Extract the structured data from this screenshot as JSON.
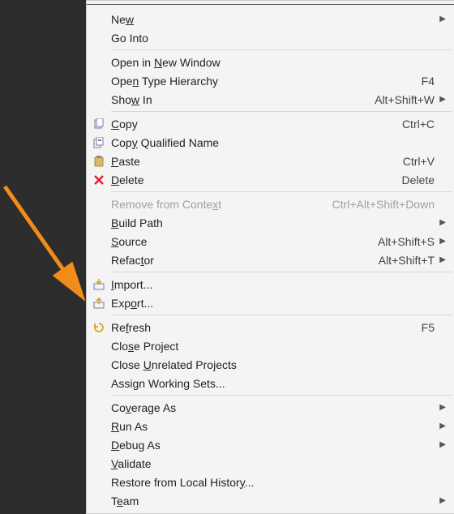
{
  "menu": {
    "groups": [
      [
        {
          "id": "new",
          "label": "Ne<u>w</u>",
          "submenu": true
        },
        {
          "id": "go-into",
          "label": "Go Into"
        }
      ],
      [
        {
          "id": "open-new-window",
          "label": "Open in <u>N</u>ew Window"
        },
        {
          "id": "open-type-hier",
          "label": "Ope<u>n</u> Type Hierarchy",
          "shortcut": "F4"
        },
        {
          "id": "show-in",
          "label": "Sho<u>w</u> In",
          "shortcut": "Alt+Shift+W",
          "submenu": true
        }
      ],
      [
        {
          "id": "copy",
          "label": "<u>C</u>opy",
          "shortcut": "Ctrl+C",
          "icon": "copy-icon"
        },
        {
          "id": "copy-qualified",
          "label": "Cop<u>y</u> Qualified Name",
          "icon": "copy-qualified-icon"
        },
        {
          "id": "paste",
          "label": "<u>P</u>aste",
          "shortcut": "Ctrl+V",
          "icon": "paste-icon"
        },
        {
          "id": "delete",
          "label": "<u>D</u>elete",
          "shortcut": "Delete",
          "icon": "delete-icon"
        }
      ],
      [
        {
          "id": "remove-context",
          "label": "Remove from Conte<u>x</u>t",
          "shortcut": "Ctrl+Alt+Shift+Down",
          "disabled": true
        },
        {
          "id": "build-path",
          "label": "<u>B</u>uild Path",
          "submenu": true
        },
        {
          "id": "source",
          "label": "<u>S</u>ource",
          "shortcut": "Alt+Shift+S",
          "submenu": true
        },
        {
          "id": "refactor",
          "label": "Refac<u>t</u>or",
          "shortcut": "Alt+Shift+T",
          "submenu": true
        }
      ],
      [
        {
          "id": "import",
          "label": "<u>I</u>mport...",
          "icon": "import-icon"
        },
        {
          "id": "export",
          "label": "Exp<u>o</u>rt...",
          "icon": "export-icon"
        }
      ],
      [
        {
          "id": "refresh",
          "label": "Re<u>f</u>resh",
          "shortcut": "F5",
          "icon": "refresh-icon"
        },
        {
          "id": "close-project",
          "label": "Clo<u>s</u>e Project"
        },
        {
          "id": "close-unrelated",
          "label": "Close <u>U</u>nrelated Projects"
        },
        {
          "id": "assign-ws",
          "label": "Assi<u>g</u>n Working Sets..."
        }
      ],
      [
        {
          "id": "coverage-as",
          "label": "Co<u>v</u>erage As",
          "submenu": true
        },
        {
          "id": "run-as",
          "label": "<u>R</u>un As",
          "submenu": true
        },
        {
          "id": "debug-as",
          "label": "<u>D</u>ebug As",
          "submenu": true
        },
        {
          "id": "validate",
          "label": "<u>V</u>alidate"
        },
        {
          "id": "restore-history",
          "label": "Restore from Local Histor<u>y</u>..."
        },
        {
          "id": "team",
          "label": "T<u>e</u>am",
          "submenu": true
        }
      ]
    ]
  },
  "annotation": {
    "arrow_target": "export"
  }
}
